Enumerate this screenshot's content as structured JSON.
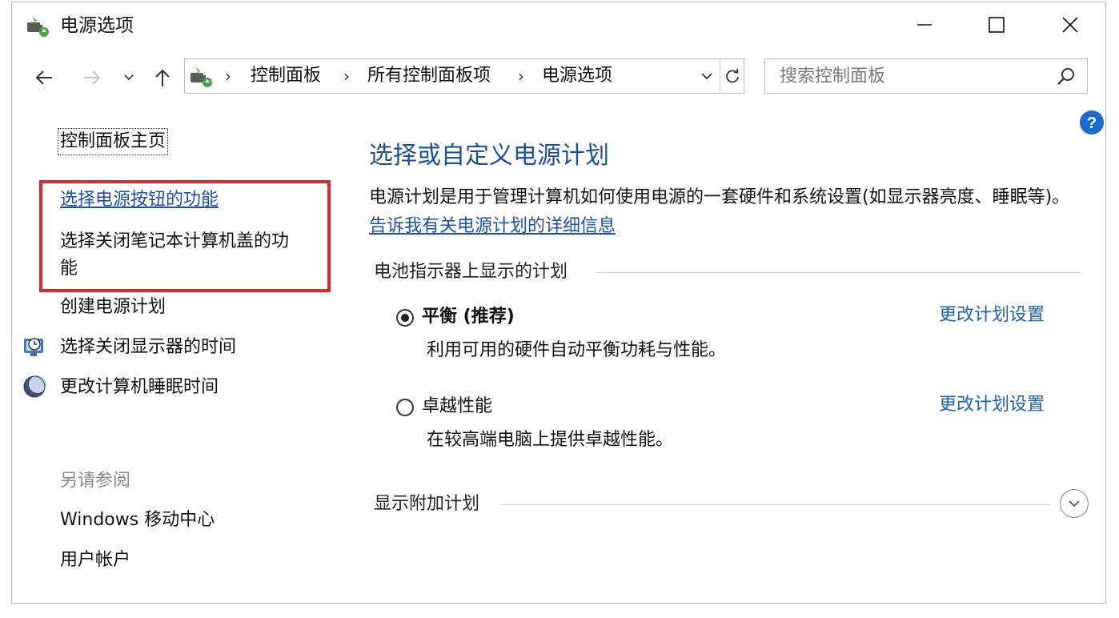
{
  "window": {
    "title": "电源选项",
    "icons": {
      "app": "power-plug-battery-icon",
      "minimize": "minimize-icon",
      "maximize": "maximize-icon",
      "close": "close-icon"
    }
  },
  "nav": {
    "icons": {
      "back": "arrow-left-icon",
      "forward": "arrow-right-icon",
      "recent": "chevron-down-icon",
      "up": "arrow-up-icon"
    },
    "breadcrumb": [
      "控制面板",
      "所有控制面板项",
      "电源选项"
    ],
    "breadcrumb_separator": "›",
    "search_placeholder": "搜索控制面板"
  },
  "sidebar": {
    "home": "控制面板主页",
    "links": [
      {
        "label": "选择电源按钮的功能",
        "style": "hyperlink"
      },
      {
        "label_line1": "选择关闭笔记本计算机盖的功",
        "label_line2": "能"
      },
      {
        "label": "创建电源计划"
      },
      {
        "label": "选择关闭显示器的时间",
        "icon": "clock-monitor-icon"
      },
      {
        "label": "更改计算机睡眠时间",
        "icon": "moon-sleep-icon"
      }
    ],
    "see_also_title": "另请参阅",
    "see_also": [
      "Windows 移动中心",
      "用户帐户"
    ],
    "highlight_color": "#e0262a"
  },
  "main": {
    "title": "选择或自定义电源计划",
    "description": "电源计划是用于管理计算机如何使用电源的一套硬件和系统设置(如显示器亮度、睡眠等)。",
    "learn_more_link": "告诉我有关电源计划的详细信息",
    "battery_group_label": "电池指示器上显示的计划",
    "plans": [
      {
        "name": "平衡 (推荐)",
        "selected": true,
        "description": "利用可用的硬件自动平衡功耗与性能。",
        "change_link": "更改计划设置"
      },
      {
        "name": "卓越性能",
        "selected": false,
        "description": "在较高端电脑上提供卓越性能。",
        "change_link": "更改计划设置"
      }
    ],
    "additional_group_label": "显示附加计划",
    "title_color": "#1e4f9e",
    "link_color": "#1f5fbf"
  }
}
